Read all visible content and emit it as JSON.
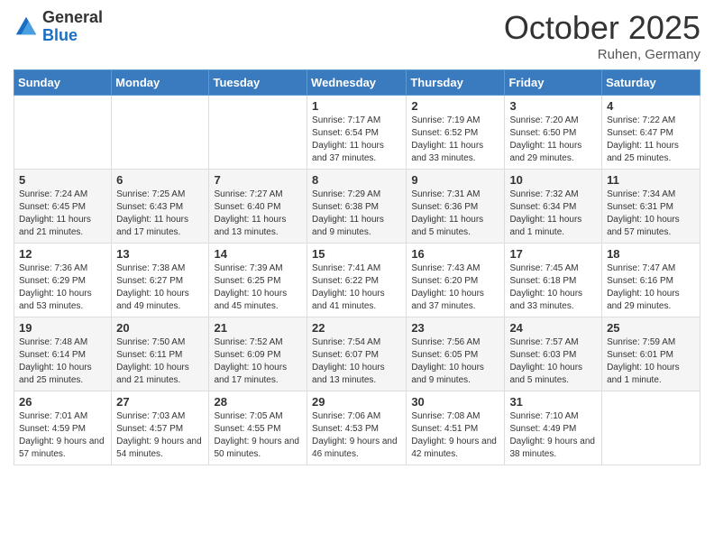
{
  "header": {
    "logo": {
      "general": "General",
      "blue": "Blue"
    },
    "title": "October 2025",
    "location": "Ruhen, Germany"
  },
  "weekdays": [
    "Sunday",
    "Monday",
    "Tuesday",
    "Wednesday",
    "Thursday",
    "Friday",
    "Saturday"
  ],
  "weeks": [
    [
      {
        "day": "",
        "info": ""
      },
      {
        "day": "",
        "info": ""
      },
      {
        "day": "",
        "info": ""
      },
      {
        "day": "1",
        "info": "Sunrise: 7:17 AM\nSunset: 6:54 PM\nDaylight: 11 hours and 37 minutes."
      },
      {
        "day": "2",
        "info": "Sunrise: 7:19 AM\nSunset: 6:52 PM\nDaylight: 11 hours and 33 minutes."
      },
      {
        "day": "3",
        "info": "Sunrise: 7:20 AM\nSunset: 6:50 PM\nDaylight: 11 hours and 29 minutes."
      },
      {
        "day": "4",
        "info": "Sunrise: 7:22 AM\nSunset: 6:47 PM\nDaylight: 11 hours and 25 minutes."
      }
    ],
    [
      {
        "day": "5",
        "info": "Sunrise: 7:24 AM\nSunset: 6:45 PM\nDaylight: 11 hours and 21 minutes."
      },
      {
        "day": "6",
        "info": "Sunrise: 7:25 AM\nSunset: 6:43 PM\nDaylight: 11 hours and 17 minutes."
      },
      {
        "day": "7",
        "info": "Sunrise: 7:27 AM\nSunset: 6:40 PM\nDaylight: 11 hours and 13 minutes."
      },
      {
        "day": "8",
        "info": "Sunrise: 7:29 AM\nSunset: 6:38 PM\nDaylight: 11 hours and 9 minutes."
      },
      {
        "day": "9",
        "info": "Sunrise: 7:31 AM\nSunset: 6:36 PM\nDaylight: 11 hours and 5 minutes."
      },
      {
        "day": "10",
        "info": "Sunrise: 7:32 AM\nSunset: 6:34 PM\nDaylight: 11 hours and 1 minute."
      },
      {
        "day": "11",
        "info": "Sunrise: 7:34 AM\nSunset: 6:31 PM\nDaylight: 10 hours and 57 minutes."
      }
    ],
    [
      {
        "day": "12",
        "info": "Sunrise: 7:36 AM\nSunset: 6:29 PM\nDaylight: 10 hours and 53 minutes."
      },
      {
        "day": "13",
        "info": "Sunrise: 7:38 AM\nSunset: 6:27 PM\nDaylight: 10 hours and 49 minutes."
      },
      {
        "day": "14",
        "info": "Sunrise: 7:39 AM\nSunset: 6:25 PM\nDaylight: 10 hours and 45 minutes."
      },
      {
        "day": "15",
        "info": "Sunrise: 7:41 AM\nSunset: 6:22 PM\nDaylight: 10 hours and 41 minutes."
      },
      {
        "day": "16",
        "info": "Sunrise: 7:43 AM\nSunset: 6:20 PM\nDaylight: 10 hours and 37 minutes."
      },
      {
        "day": "17",
        "info": "Sunrise: 7:45 AM\nSunset: 6:18 PM\nDaylight: 10 hours and 33 minutes."
      },
      {
        "day": "18",
        "info": "Sunrise: 7:47 AM\nSunset: 6:16 PM\nDaylight: 10 hours and 29 minutes."
      }
    ],
    [
      {
        "day": "19",
        "info": "Sunrise: 7:48 AM\nSunset: 6:14 PM\nDaylight: 10 hours and 25 minutes."
      },
      {
        "day": "20",
        "info": "Sunrise: 7:50 AM\nSunset: 6:11 PM\nDaylight: 10 hours and 21 minutes."
      },
      {
        "day": "21",
        "info": "Sunrise: 7:52 AM\nSunset: 6:09 PM\nDaylight: 10 hours and 17 minutes."
      },
      {
        "day": "22",
        "info": "Sunrise: 7:54 AM\nSunset: 6:07 PM\nDaylight: 10 hours and 13 minutes."
      },
      {
        "day": "23",
        "info": "Sunrise: 7:56 AM\nSunset: 6:05 PM\nDaylight: 10 hours and 9 minutes."
      },
      {
        "day": "24",
        "info": "Sunrise: 7:57 AM\nSunset: 6:03 PM\nDaylight: 10 hours and 5 minutes."
      },
      {
        "day": "25",
        "info": "Sunrise: 7:59 AM\nSunset: 6:01 PM\nDaylight: 10 hours and 1 minute."
      }
    ],
    [
      {
        "day": "26",
        "info": "Sunrise: 7:01 AM\nSunset: 4:59 PM\nDaylight: 9 hours and 57 minutes."
      },
      {
        "day": "27",
        "info": "Sunrise: 7:03 AM\nSunset: 4:57 PM\nDaylight: 9 hours and 54 minutes."
      },
      {
        "day": "28",
        "info": "Sunrise: 7:05 AM\nSunset: 4:55 PM\nDaylight: 9 hours and 50 minutes."
      },
      {
        "day": "29",
        "info": "Sunrise: 7:06 AM\nSunset: 4:53 PM\nDaylight: 9 hours and 46 minutes."
      },
      {
        "day": "30",
        "info": "Sunrise: 7:08 AM\nSunset: 4:51 PM\nDaylight: 9 hours and 42 minutes."
      },
      {
        "day": "31",
        "info": "Sunrise: 7:10 AM\nSunset: 4:49 PM\nDaylight: 9 hours and 38 minutes."
      },
      {
        "day": "",
        "info": ""
      }
    ]
  ]
}
